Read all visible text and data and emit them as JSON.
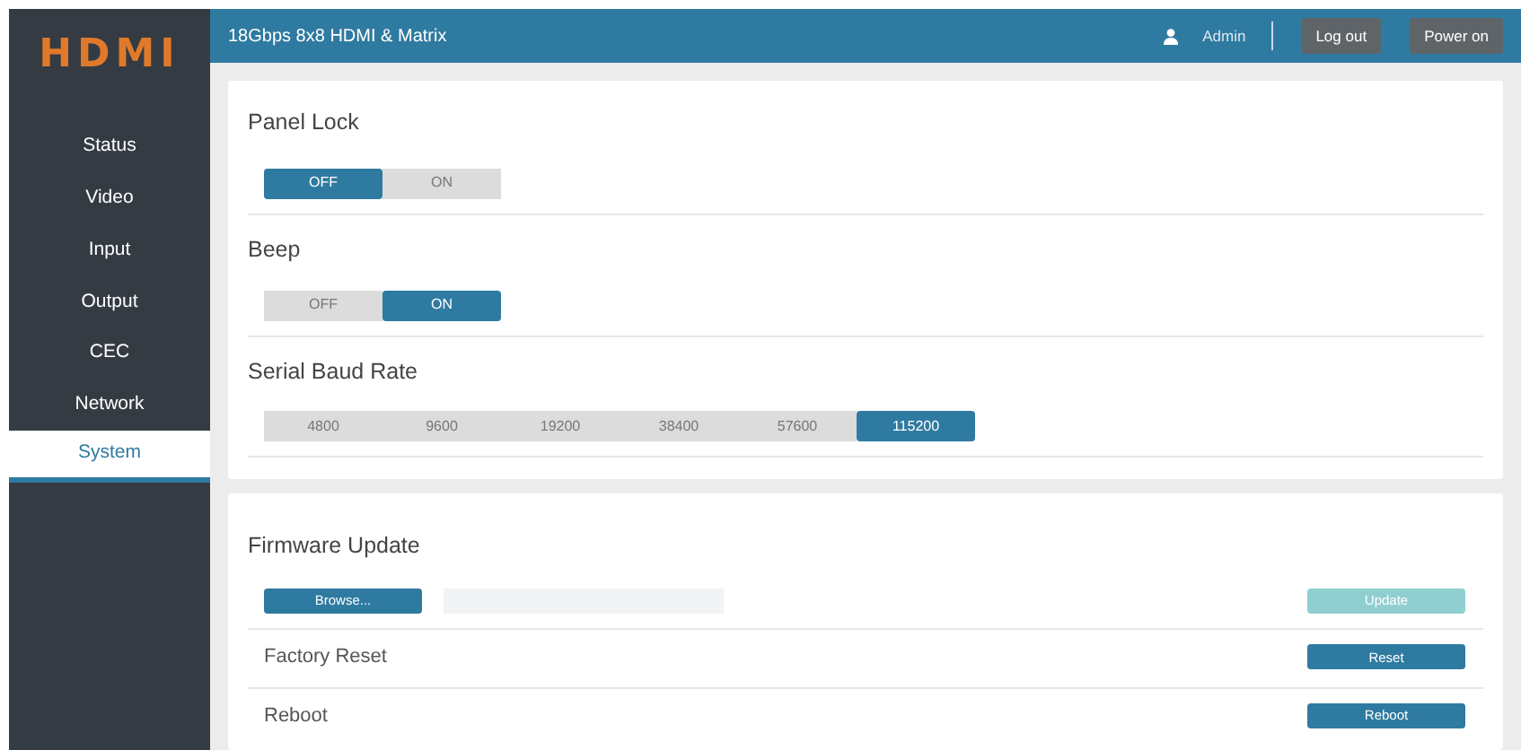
{
  "logo": "HDMI",
  "sidebar": {
    "items": [
      {
        "label": "Status",
        "selected": false
      },
      {
        "label": "Video",
        "selected": false
      },
      {
        "label": "Input",
        "selected": false
      },
      {
        "label": "Output",
        "selected": false
      },
      {
        "label": "CEC",
        "selected": false
      },
      {
        "label": "Network",
        "selected": false
      },
      {
        "label": "System",
        "selected": true
      }
    ]
  },
  "header": {
    "title": "18Gbps 8x8 HDMI & Matrix",
    "user": "Admin",
    "buttons": [
      "Log out",
      "Power on"
    ]
  },
  "settings": [
    {
      "title": "Panel Lock",
      "options": [
        {
          "label": "OFF",
          "selected": true
        },
        {
          "label": "ON",
          "selected": false
        }
      ]
    },
    {
      "title": "Beep",
      "options": [
        {
          "label": "OFF",
          "selected": false
        },
        {
          "label": "ON",
          "selected": true
        }
      ]
    },
    {
      "title": "Serial Baud Rate",
      "options": [
        {
          "label": "4800",
          "selected": false
        },
        {
          "label": "9600",
          "selected": false
        },
        {
          "label": "19200",
          "selected": false
        },
        {
          "label": "38400",
          "selected": false
        },
        {
          "label": "57600",
          "selected": false
        },
        {
          "label": "115200",
          "selected": true
        }
      ]
    }
  ],
  "firmware": {
    "title": "Firmware Update",
    "browse": "Browse...",
    "update": {
      "label": "Update",
      "disabled": true
    },
    "actions": [
      {
        "label": "Factory Reset",
        "button": "Reset"
      },
      {
        "label": "Reboot",
        "button": "Reboot"
      }
    ]
  }
}
